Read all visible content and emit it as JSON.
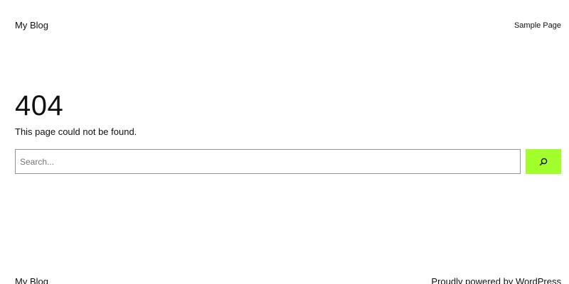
{
  "header": {
    "site_title": "My Blog",
    "nav": [
      {
        "label": "Sample Page"
      }
    ]
  },
  "main": {
    "error_code": "404",
    "error_message": "This page could not be found.",
    "search": {
      "placeholder": "Search...",
      "value": "",
      "button_icon": "search-icon",
      "button_color": "#a3ff2c"
    }
  },
  "footer": {
    "site_title": "My Blog",
    "credit_prefix": "Proudly powered by ",
    "credit_link": "WordPress"
  }
}
